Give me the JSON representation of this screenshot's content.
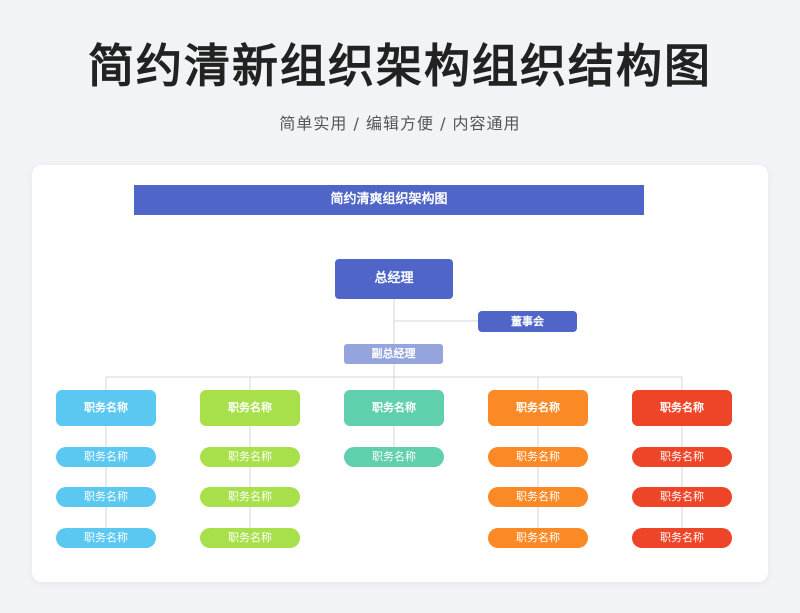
{
  "header": {
    "title": "简约清新组织架构组织结构图",
    "subtitle": "简单实用 / 编辑方便 / 内容通用"
  },
  "chart": {
    "banner": "简约清爽组织架构图",
    "general_manager": "总经理",
    "board": "董事会",
    "deputy_manager": "副总经理",
    "departments": [
      {
        "label": "职务名称",
        "color": "#5bc8f2",
        "positions": [
          "职务名称",
          "职务名称",
          "职务名称"
        ]
      },
      {
        "label": "职务名称",
        "color": "#a8e04b",
        "positions": [
          "职务名称",
          "职务名称",
          "职务名称"
        ]
      },
      {
        "label": "职务名称",
        "color": "#5fcfad",
        "positions": [
          "职务名称"
        ]
      },
      {
        "label": "职务名称",
        "color": "#fb8a26",
        "positions": [
          "职务名称",
          "职务名称",
          "职务名称"
        ]
      },
      {
        "label": "职务名称",
        "color": "#ee4528",
        "positions": [
          "职务名称",
          "职务名称",
          "职务名称"
        ]
      }
    ],
    "colors": {
      "primary": "#4f66c8",
      "deputy": "#95a4dd",
      "connector": "#d0d4dc"
    }
  }
}
